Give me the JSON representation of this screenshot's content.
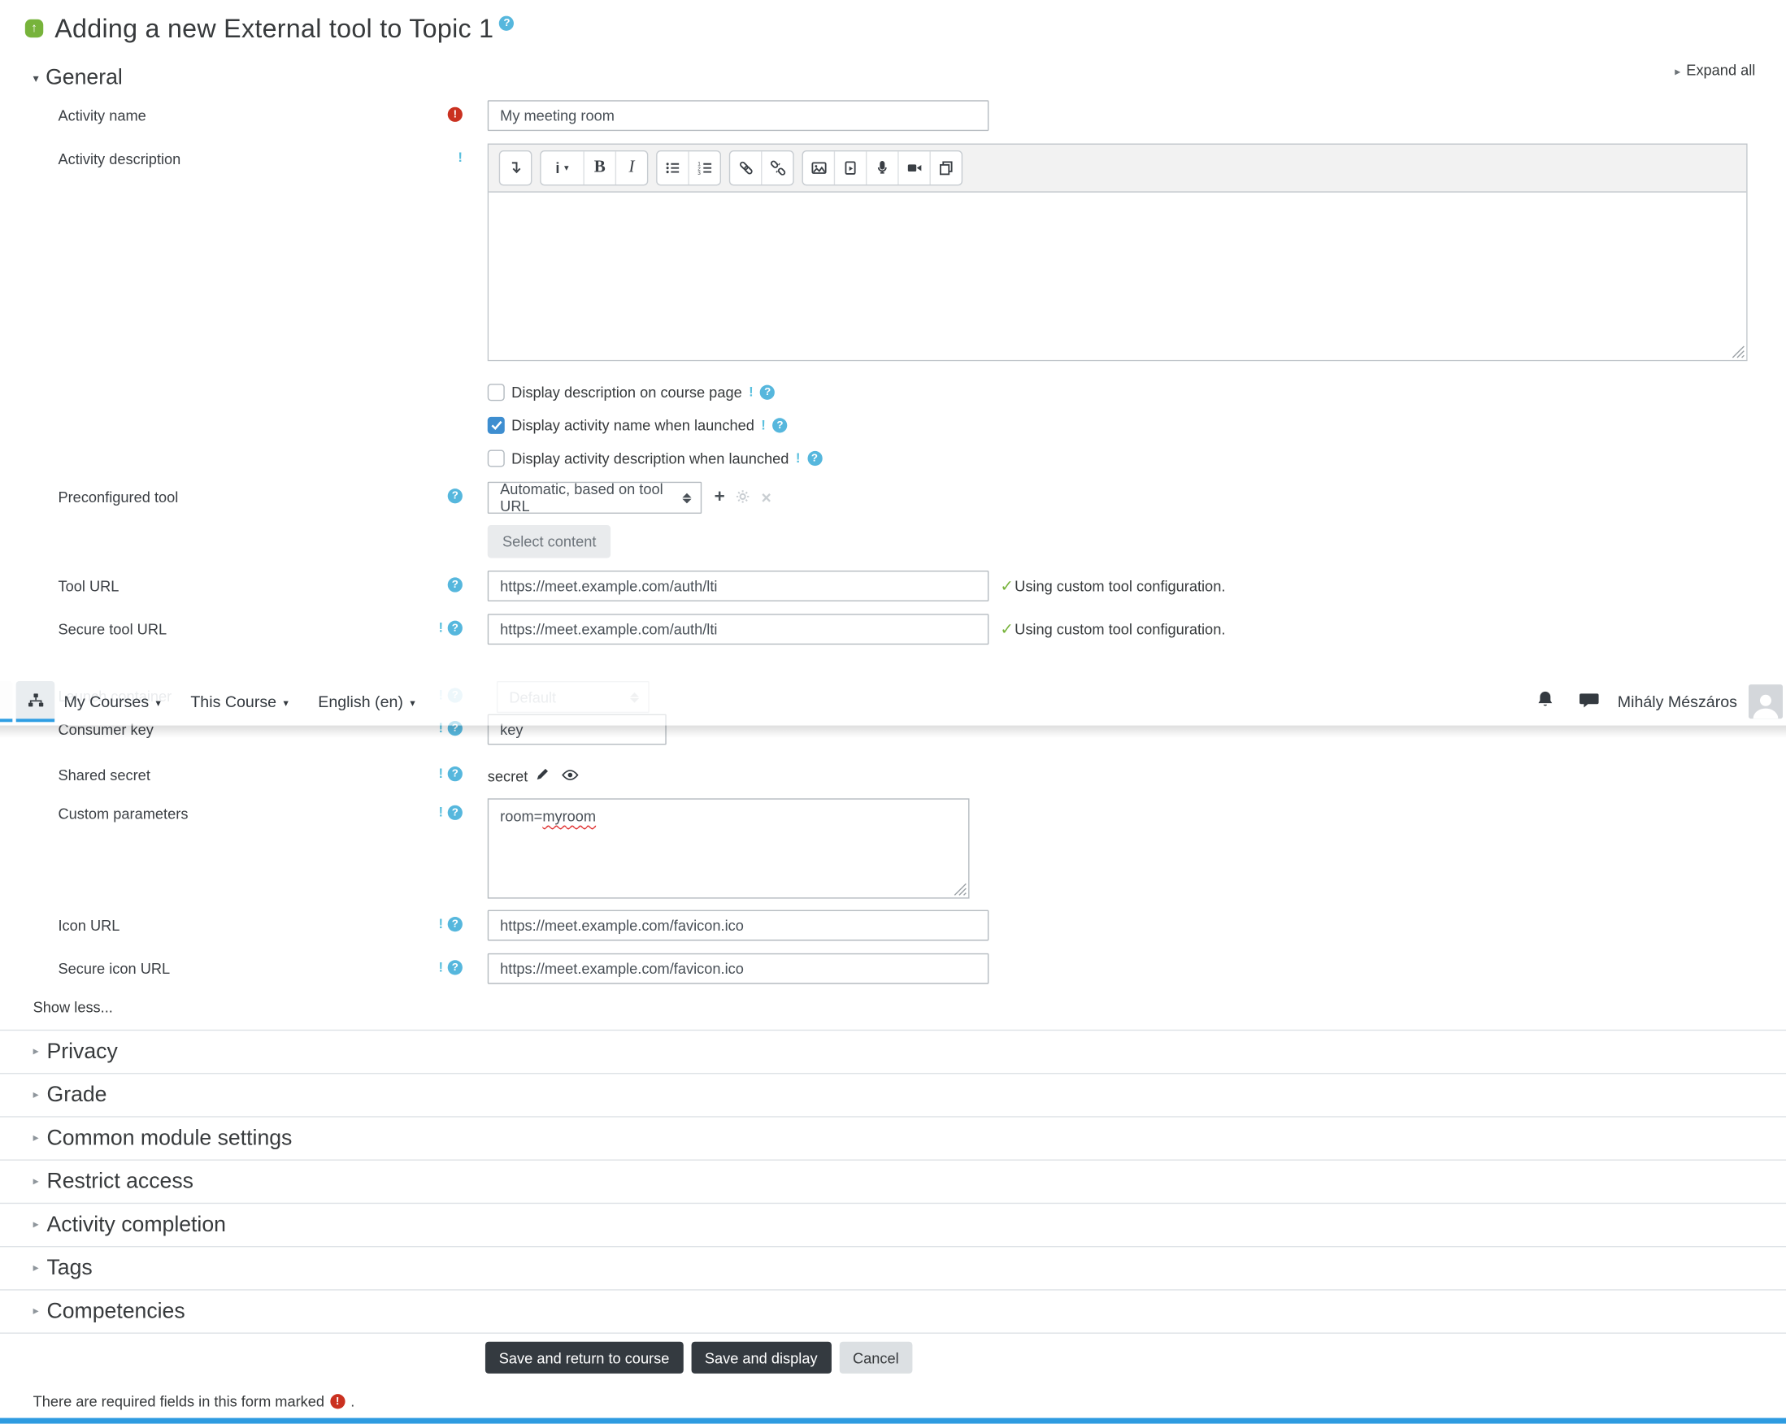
{
  "page": {
    "title": "Adding a new External tool to Topic 1",
    "expand_all": "Expand all",
    "show_less": "Show less...",
    "required_note": "There are required fields in this form marked",
    "required_note_suffix": ".",
    "accent_green": "#77b33b",
    "help_blue": "#56b7dd",
    "required_red": "#ca3120",
    "checkbox_blue": "#3e8ed0",
    "nav_underline_blue": "#2f9ee3"
  },
  "icons": {
    "help_glyph": "?",
    "warning_glyph": "!",
    "required_glyph": "!",
    "check_glyph": "✓",
    "caret_down_glyph": "▾",
    "caret_right_glyph": "▸",
    "up_arrow_glyph": "↑",
    "plus_glyph": "+",
    "close_glyph": "×"
  },
  "navbar": {
    "menus": [
      {
        "label": "My Courses"
      },
      {
        "label": "This Course"
      },
      {
        "label": "English (en)"
      }
    ],
    "user_name": "Mihály Mészáros",
    "icon_names": [
      "sitemap-icon",
      "bell-icon",
      "messages-icon",
      "avatar"
    ]
  },
  "general": {
    "heading": "General",
    "activity_name": {
      "label": "Activity name",
      "value": "My meeting room"
    },
    "activity_description": {
      "label": "Activity description"
    },
    "checkboxes": [
      {
        "label": "Display description on course page",
        "checked": false
      },
      {
        "label": "Display activity name when launched",
        "checked": true
      },
      {
        "label": "Display activity description when launched",
        "checked": false
      }
    ],
    "preconfigured_tool": {
      "label": "Preconfigured tool",
      "value": "Automatic, based on tool URL",
      "button": "Select content"
    },
    "tool_url": {
      "label": "Tool URL",
      "value": "https://meet.example.com/auth/lti",
      "status": "Using custom tool configuration."
    },
    "secure_tool_url": {
      "label": "Secure tool URL",
      "value": "https://meet.example.com/auth/lti",
      "status": "Using custom tool configuration."
    },
    "launch_container": {
      "label": "Launch container",
      "value": "Default"
    },
    "consumer_key": {
      "label": "Consumer key",
      "value": "key"
    },
    "shared_secret": {
      "label": "Shared secret",
      "value": "secret"
    },
    "custom_parameters": {
      "label": "Custom parameters",
      "value_prefix": "room=",
      "value_misspelled": "myroom"
    },
    "icon_url": {
      "label": "Icon URL",
      "value": "https://meet.example.com/favicon.ico"
    },
    "secure_icon_url": {
      "label": "Secure icon URL",
      "value": "https://meet.example.com/favicon.ico"
    }
  },
  "editor": {
    "bold": "B",
    "italic": "I",
    "style_menu": "i",
    "toolbar_icon_names": [
      "collapse-toolbar-icon",
      "paragraph-style-menu",
      "bold-button",
      "italic-button",
      "unordered-list-icon",
      "ordered-list-icon",
      "link-icon",
      "unlink-icon",
      "image-icon",
      "media-icon",
      "record-audio-icon",
      "record-video-icon",
      "manage-files-icon"
    ]
  },
  "sections": [
    "Privacy",
    "Grade",
    "Common module settings",
    "Restrict access",
    "Activity completion",
    "Tags",
    "Competencies"
  ],
  "buttons": {
    "save_return": "Save and return to course",
    "save_display": "Save and display",
    "cancel": "Cancel"
  }
}
